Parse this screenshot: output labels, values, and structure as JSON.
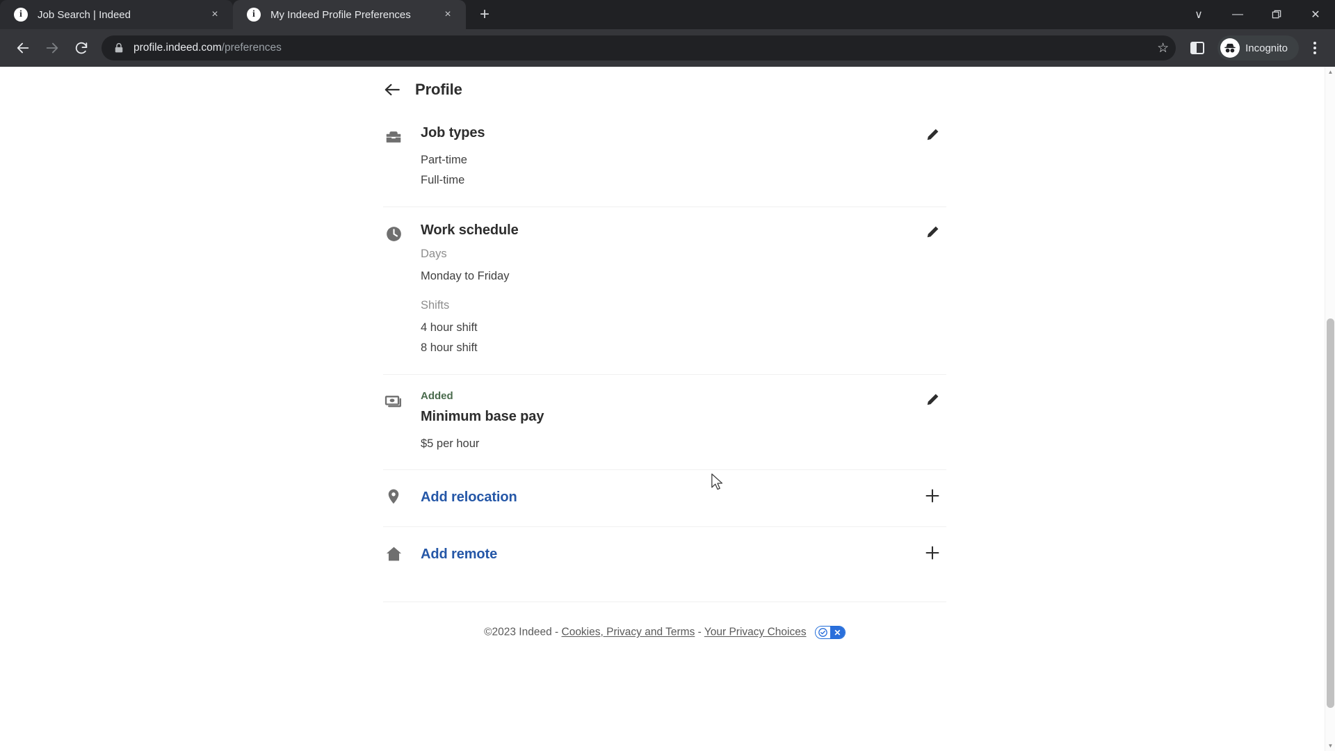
{
  "browser": {
    "tabs": [
      {
        "title": "Job Search | Indeed",
        "active": false,
        "favicon": "info-icon",
        "close_label": "×"
      },
      {
        "title": "My Indeed Profile Preferences",
        "active": true,
        "favicon": "info-icon",
        "close_label": "×"
      }
    ],
    "new_tab_label": "+",
    "window_controls": {
      "list_tabs": "∨",
      "minimize": "—",
      "maximize": "❐",
      "close": "✕"
    },
    "nav": {
      "back": "←",
      "forward": "→",
      "reload": "↻"
    },
    "omnibox": {
      "lock_icon": "lock-icon",
      "url_domain": "profile.indeed.com",
      "url_path": "/preferences",
      "star_icon": "☆"
    },
    "profile": {
      "label": "Incognito",
      "avatar_icon": "incognito-icon"
    },
    "menu_icon": "kebab-menu-icon"
  },
  "page": {
    "header": {
      "back_icon": "back-arrow-icon",
      "title": "Profile"
    },
    "sections": [
      {
        "id": "job-types",
        "icon": "toolbox-icon",
        "title": "Job types",
        "action": "edit",
        "action_icon": "pencil-icon",
        "groups": [
          {
            "label": "",
            "values": [
              "Part-time",
              "Full-time"
            ]
          }
        ]
      },
      {
        "id": "work-schedule",
        "icon": "clock-icon",
        "title": "Work schedule",
        "action": "edit",
        "action_icon": "pencil-icon",
        "groups": [
          {
            "label": "Days",
            "values": [
              "Monday to Friday"
            ]
          },
          {
            "label": "Shifts",
            "values": [
              "4 hour shift",
              "8 hour shift"
            ]
          }
        ]
      },
      {
        "id": "minimum-base-pay",
        "icon": "money-icon",
        "badge": "Added",
        "title": "Minimum base pay",
        "action": "edit",
        "action_icon": "pencil-icon",
        "groups": [
          {
            "label": "",
            "values": [
              "$5 per hour"
            ]
          }
        ]
      },
      {
        "id": "add-relocation",
        "icon": "map-pin-icon",
        "link_title": "Add relocation",
        "action": "add",
        "action_icon": "plus-icon"
      },
      {
        "id": "add-remote",
        "icon": "home-icon",
        "link_title": "Add remote",
        "action": "add",
        "action_icon": "plus-icon"
      }
    ],
    "footer": {
      "copyright": "©2023 Indeed -",
      "cookies_link": "Cookies, Privacy and Terms",
      "separator": "-",
      "privacy_link": "Your Privacy Choices",
      "privacy_badge_check": "✓",
      "privacy_badge_x": "✕"
    }
  },
  "colors": {
    "accent_link": "#2557a7",
    "added_green": "#4a6b4d",
    "chrome_dark": "#35363a",
    "tabstrip": "#202124"
  }
}
